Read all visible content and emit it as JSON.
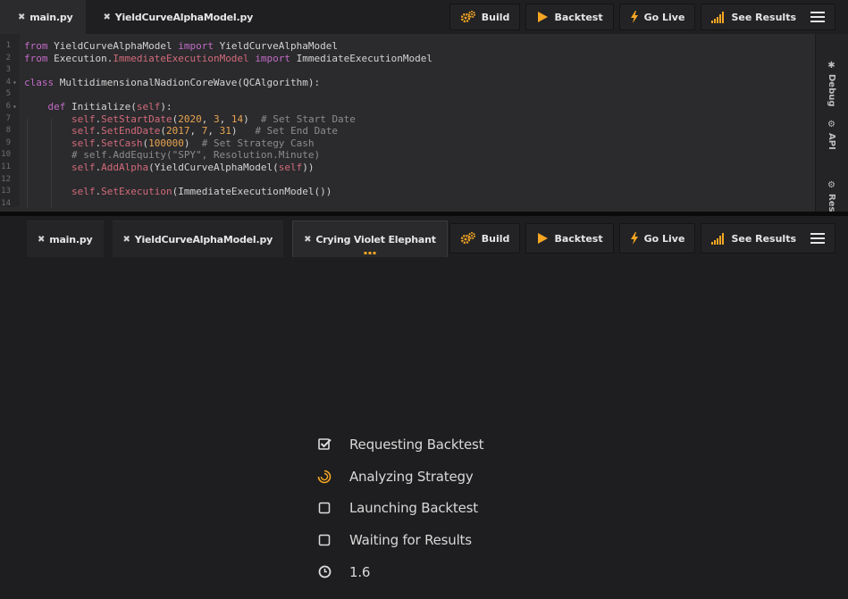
{
  "colors": {
    "accent": "#f5a623",
    "background": "#1e1e20",
    "editor_bg": "#2b2b2d"
  },
  "top": {
    "tabs": [
      {
        "label": "main.py",
        "close_icon": "close-icon"
      },
      {
        "label": "YieldCurveAlphaModel.py",
        "close_icon": "close-icon"
      }
    ],
    "toolbar": {
      "build": "Build",
      "backtest": "Backtest",
      "go_live": "Go Live",
      "see_results": "See Results"
    },
    "side_tabs": {
      "debug": "Debug",
      "api": "API",
      "res": "Res"
    },
    "code": {
      "lines": [
        {
          "n": "1",
          "html": "<span class=\"kw\">from</span> YieldCurveAlphaModel <span class=\"kw\">import</span> YieldCurveAlphaModel"
        },
        {
          "n": "2",
          "html": "<span class=\"kw\">from</span> Execution.<span class=\"call\">ImmediateExecutionModel</span> <span class=\"kw\">import</span> ImmediateExecutionModel"
        },
        {
          "n": "3",
          "html": ""
        },
        {
          "n": "4",
          "fold": true,
          "html": "<span class=\"kw\">class</span> MultidimensionalNadionCoreWave(QCAlgorithm):"
        },
        {
          "n": "5",
          "html": ""
        },
        {
          "n": "6",
          "fold": true,
          "html": "    <span class=\"kw\">def</span> Initialize(<span class=\"selfkw\">self</span>):"
        },
        {
          "n": "7",
          "html": "        <span class=\"selfkw\">self</span>.<span class=\"call\">SetStartDate</span>(<span class=\"num\">2020</span>, <span class=\"num\">3</span>, <span class=\"num\">14</span>)  <span class=\"cm\"># Set Start Date</span>"
        },
        {
          "n": "8",
          "html": "        <span class=\"selfkw\">self</span>.<span class=\"call\">SetEndDate</span>(<span class=\"num\">2017</span>, <span class=\"num\">7</span>, <span class=\"num\">31</span>)   <span class=\"cm\"># Set End Date</span>"
        },
        {
          "n": "9",
          "html": "        <span class=\"selfkw\">self</span>.<span class=\"call\">SetCash</span>(<span class=\"num\">100000</span>)  <span class=\"cm\"># Set Strategy Cash</span>"
        },
        {
          "n": "10",
          "html": "        <span class=\"cm\"># self.AddEquity(\"SPY\", Resolution.Minute)</span>"
        },
        {
          "n": "11",
          "html": "        <span class=\"selfkw\">self</span>.<span class=\"call\">AddAlpha</span>(YieldCurveAlphaModel(<span class=\"selfkw\">self</span>))"
        },
        {
          "n": "12",
          "html": ""
        },
        {
          "n": "13",
          "html": "        <span class=\"selfkw\">self</span>.<span class=\"call\">SetExecution</span>(ImmediateExecutionModel())"
        },
        {
          "n": "14",
          "html": ""
        }
      ]
    }
  },
  "bottom": {
    "tabs": [
      {
        "label": "main.py"
      },
      {
        "label": "YieldCurveAlphaModel.py"
      },
      {
        "label": "Crying Violet Elephant"
      }
    ],
    "toolbar": {
      "build": "Build",
      "backtest": "Backtest",
      "go_live": "Go Live",
      "see_results": "See Results"
    },
    "status": [
      {
        "icon": "checked-checkbox-icon",
        "label": "Requesting Backtest"
      },
      {
        "icon": "spinner-icon",
        "label": "Analyzing Strategy"
      },
      {
        "icon": "empty-checkbox-icon",
        "label": "Launching Backtest"
      },
      {
        "icon": "empty-checkbox-icon",
        "label": "Waiting for Results"
      },
      {
        "icon": "clock-icon",
        "label": "1.6"
      }
    ]
  }
}
